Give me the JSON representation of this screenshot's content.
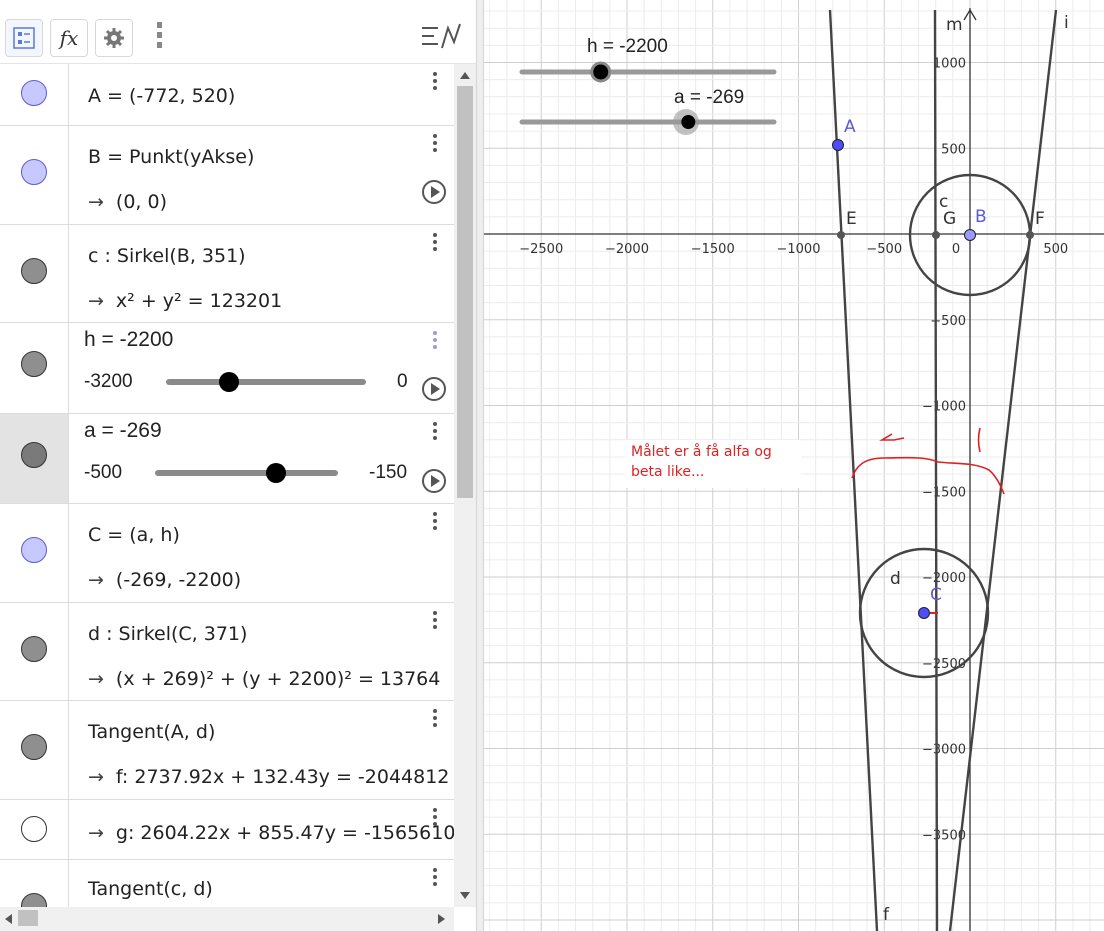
{
  "toolbar": {
    "buttons": [
      {
        "icon": "algebra-view-icon"
      },
      {
        "icon": "fx-icon",
        "label": "𝑓𝑥"
      },
      {
        "icon": "gear-icon"
      },
      {
        "icon": "more-vert-icon"
      }
    ],
    "menu_icon": "perspectives-menu-icon"
  },
  "algebra": {
    "rows": [
      {
        "line1": "A = (-772, 520)",
        "dot": "blue"
      },
      {
        "line1": "B = Punkt(yAkse)",
        "line2": "(0, 0)",
        "dot": "blue"
      },
      {
        "line1": "c : Sirkel(B, 351)",
        "line2": "x² + y² = 123201",
        "dot": "gray"
      },
      {
        "title": "h = -2200",
        "min": "-3200",
        "max": "0",
        "dot": "gray",
        "value": -2200,
        "range": [
          -3200,
          0
        ]
      },
      {
        "title": "a = -269",
        "min": "-500",
        "max": "-150",
        "dot": "gray",
        "value": -269,
        "range": [
          -500,
          -150
        ]
      },
      {
        "line1": "C = (a, h)",
        "line2": "(-269, -2200)",
        "dot": "blue"
      },
      {
        "line1": "d : Sirkel(C, 371)",
        "line2": "(x + 269)² + (y + 2200)² = 13764",
        "dot": "gray"
      },
      {
        "line1": "Tangent(A, d)",
        "line2": "f: 2737.92x + 132.43y = -2044812",
        "dot": "gray"
      },
      {
        "line2": "g: 2604.22x + 855.47y = -1565610",
        "dot": "white"
      },
      {
        "line1": "Tangent(c, d)",
        "dot": "gray"
      }
    ],
    "arrow": "→"
  },
  "graphics": {
    "sliders": [
      {
        "label": "h = -2200",
        "value": -2200,
        "range": [
          -3200,
          0
        ]
      },
      {
        "label": "a = -269",
        "value": -269,
        "range": [
          -500,
          -150
        ]
      }
    ],
    "x_ticks": [
      "-2500",
      "-2000",
      "-1500",
      "-1000",
      "-500",
      "0",
      "500"
    ],
    "y_ticks": [
      "1000",
      "500",
      "-500",
      "-1000",
      "-1500",
      "-2000",
      "-2500",
      "-3000",
      "-3500"
    ],
    "labels": {
      "m": "m",
      "i": "i",
      "f": "f",
      "A": "A",
      "B": "B",
      "C": "C",
      "E": "E",
      "F": "F",
      "G": "G",
      "c": "c",
      "d": "d"
    },
    "note": "Målet er å få alfa og\nbeta like...",
    "colors": {
      "point": "#4d4dff",
      "annotation": "#dd2222",
      "lines": "#444444"
    }
  }
}
